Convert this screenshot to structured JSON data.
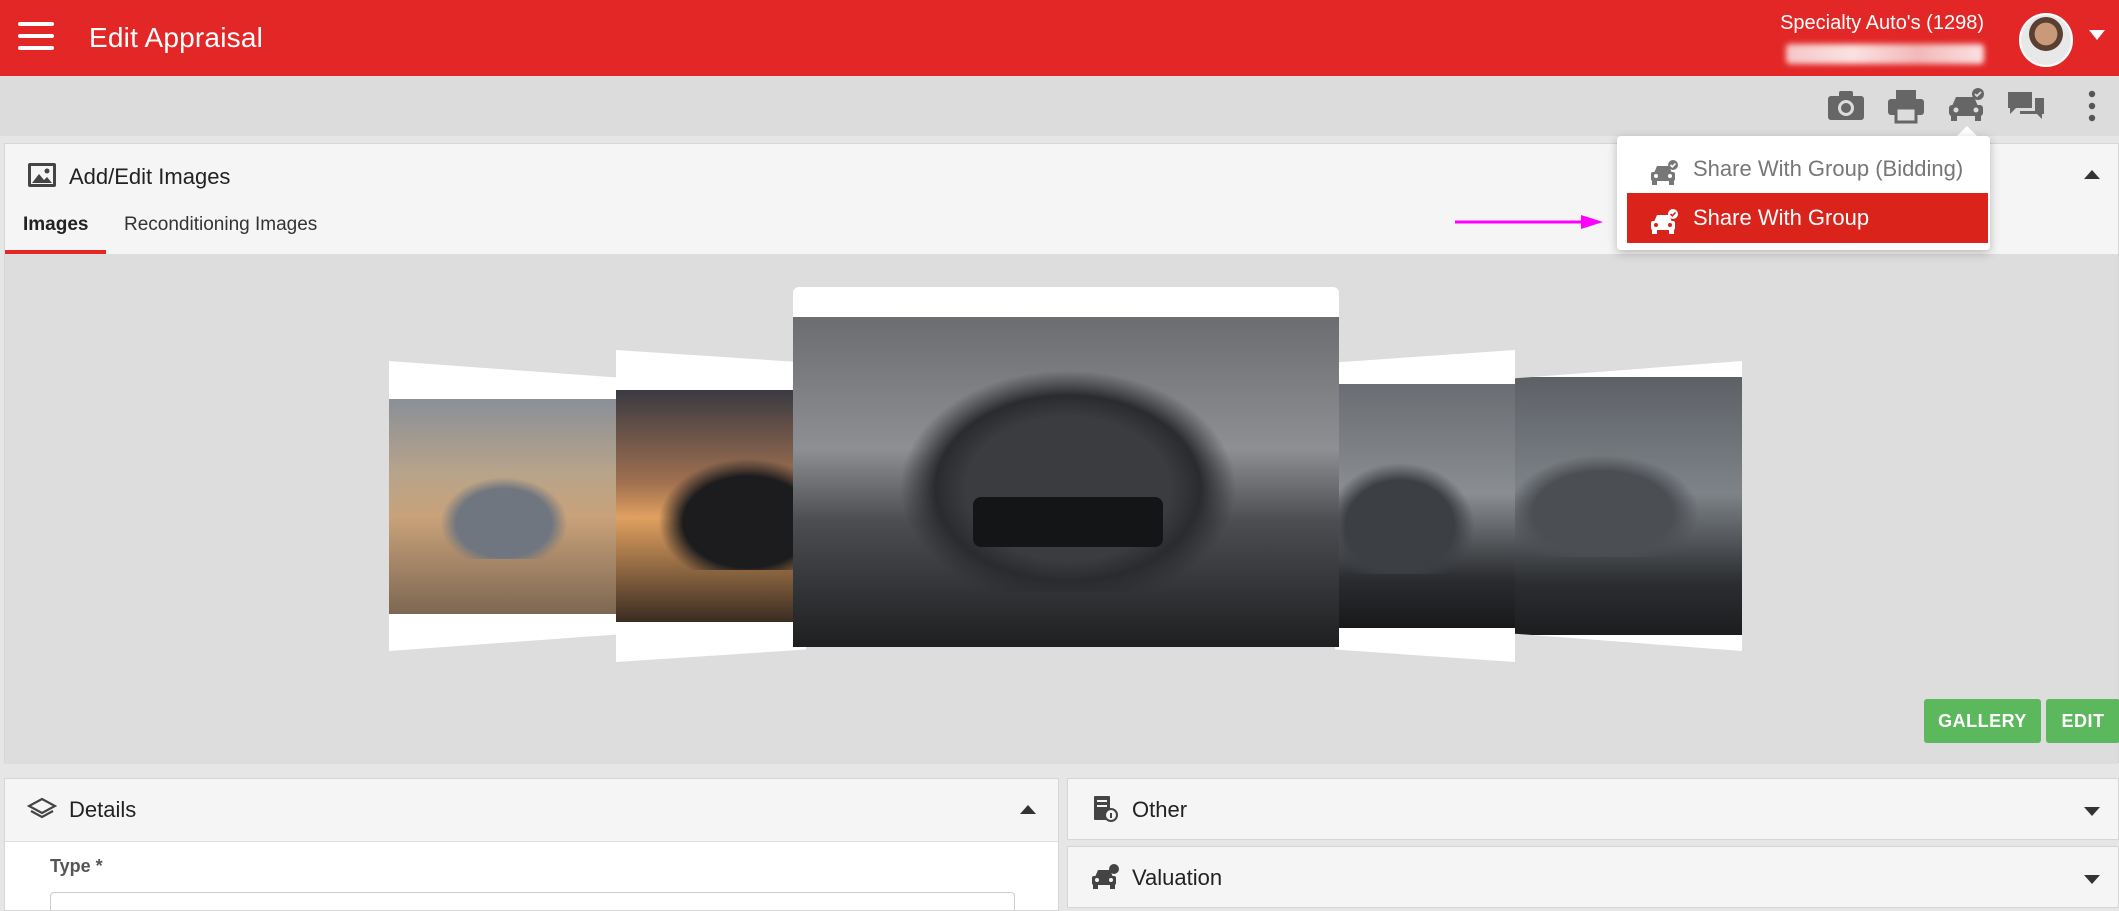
{
  "header": {
    "title": "Edit Appraisal",
    "dealer": "Specialty Auto's (1298)"
  },
  "panel_images": {
    "title": "Add/Edit Images",
    "tabs": [
      {
        "label": "Images"
      },
      {
        "label": "Reconditioning Images"
      }
    ],
    "buttons": {
      "gallery": "GALLERY",
      "edit": "EDIT"
    }
  },
  "dropdown": {
    "items": [
      {
        "label": "Share With Group (Bidding)"
      },
      {
        "label": "Share With Group"
      }
    ]
  },
  "details": {
    "title": "Details",
    "field_label": "Type *"
  },
  "other": {
    "title": "Other"
  },
  "valuation": {
    "title": "Valuation"
  },
  "colors": {
    "accent": "#e32727",
    "menu_highlight": "#d9231b",
    "button_green": "#5cb85c",
    "annotation_arrow": "#ff00ff"
  },
  "icons": [
    "hamburger-icon",
    "camera-icon",
    "print-icon",
    "car-share-icon",
    "chat-icon",
    "more-vert-icon",
    "image-icon",
    "layers-icon",
    "document-info-icon",
    "car-dollar-icon"
  ]
}
